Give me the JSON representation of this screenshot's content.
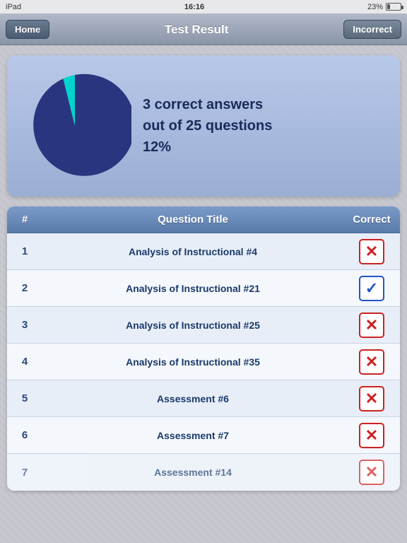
{
  "status_bar": {
    "device": "iPad",
    "time": "16:16",
    "battery_percent": "23%"
  },
  "nav_bar": {
    "home_button": "Home",
    "title": "Test Result",
    "incorrect_button": "Incorrect"
  },
  "summary": {
    "correct_count": 3,
    "total_questions": 25,
    "percentage": "12%",
    "description_line1": "3 correct answers",
    "description_line2": "out of 25 questions",
    "description_line3": "12%"
  },
  "table": {
    "headers": [
      "#",
      "Question Title",
      "Correct"
    ],
    "rows": [
      {
        "number": "1",
        "title": "Analysis of Instructional #4",
        "correct": false
      },
      {
        "number": "2",
        "title": "Analysis of Instructional #21",
        "correct": true
      },
      {
        "number": "3",
        "title": "Analysis of Instructional #25",
        "correct": false
      },
      {
        "number": "4",
        "title": "Analysis of Instructional #35",
        "correct": false
      },
      {
        "number": "5",
        "title": "Assessment #6",
        "correct": false
      },
      {
        "number": "6",
        "title": "Assessment #7",
        "correct": false
      },
      {
        "number": "7",
        "title": "Assessment #14",
        "correct": false
      }
    ]
  },
  "pie_chart": {
    "correct_pct": 12,
    "incorrect_pct": 88,
    "correct_color": "#00d4cc",
    "incorrect_color": "#2a3580"
  }
}
